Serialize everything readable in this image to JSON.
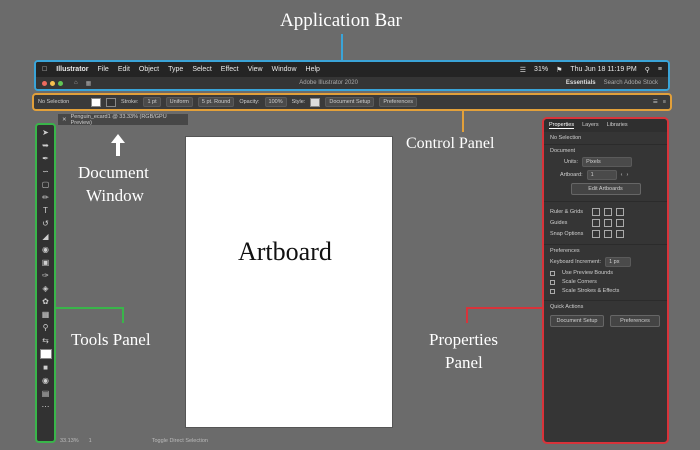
{
  "annotations": {
    "application_bar": "Application Bar",
    "control_panel": "Control Panel",
    "document_window_1": "Document",
    "document_window_2": "Window",
    "tools_panel": "Tools Panel",
    "properties_panel_1": "Properties",
    "properties_panel_2": "Panel",
    "artboard": "Artboard"
  },
  "appbar": {
    "app_name": "Illustrator",
    "menu": [
      "File",
      "Edit",
      "Object",
      "Type",
      "Select",
      "Effect",
      "View",
      "Window",
      "Help"
    ],
    "battery": "31%",
    "datetime": "Thu Jun 18  11:19 PM",
    "doc_title": "Adobe Illustrator 2020",
    "workspace": "Essentials",
    "search_placeholder": "Search Adobe Stock"
  },
  "control": {
    "selection": "No Selection",
    "stroke_label": "Stroke:",
    "stroke_value": "1 pt",
    "stroke_style": "Uniform",
    "brush": "5 pt. Round",
    "opacity_label": "Opacity:",
    "opacity_value": "100%",
    "style_label": "Style:",
    "doc_setup": "Document Setup",
    "preferences": "Preferences"
  },
  "document": {
    "tab_title": "Penguin_ecard1 @ 33.33% (RGB/GPU Preview)"
  },
  "properties": {
    "tabs": [
      "Properties",
      "Layers",
      "Libraries"
    ],
    "no_selection": "No Selection",
    "document_heading": "Document",
    "units_label": "Units:",
    "units_value": "Pixels",
    "artboard_label": "Artboard:",
    "artboard_value": "1",
    "edit_artboards": "Edit Artboards",
    "ruler_grids": "Ruler & Grids",
    "guides": "Guides",
    "snap_options": "Snap Options",
    "preferences_heading": "Preferences",
    "keyboard_increment_label": "Keyboard Increment:",
    "keyboard_increment_value": "1 px",
    "use_preview_bounds": "Use Preview Bounds",
    "scale_corners": "Scale Corners",
    "scale_strokes": "Scale Strokes & Effects",
    "quick_actions": "Quick Actions",
    "document_setup_btn": "Document Setup",
    "preferences_btn": "Preferences"
  },
  "status": {
    "zoom": "33.13%",
    "artboard_num": "1",
    "tool": "Toggle Direct Selection"
  },
  "colors": {
    "application_bar": "#3aa4d8",
    "control_panel": "#e2a03a",
    "tools_panel": "#39b54a",
    "properties_panel": "#d8333a"
  }
}
